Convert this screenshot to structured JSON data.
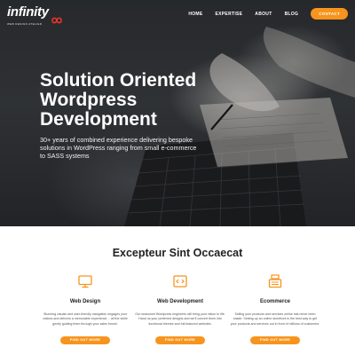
{
  "nav": {
    "logo_word": "infinity",
    "logo_sub": "WEB DESIGN ATELIER",
    "links": [
      "HOME",
      "EXPERTISE",
      "ABOUT",
      "BLOG"
    ],
    "contact_label": "CONTACT"
  },
  "hero": {
    "title_lines": [
      "Solution Oriented",
      "Wordpress",
      "Development"
    ],
    "subtitle": "30+ years of combined experience delivering bespoke solutions in WordPress ranging from small e-commerce to SASS systems"
  },
  "services": {
    "heading": "Excepteur Sint Occaecat",
    "cards": [
      {
        "icon": "monitor-icon",
        "title": "Web Design",
        "description": "Stunning visuals and user-friendly navigation engages your visitors and delivers a memorable experience… all the while gently guiding them through your sales funnel.",
        "button": "FIND OUT MORE"
      },
      {
        "icon": "code-icon",
        "title": "Web Development",
        "description": "Our seasoned Wordpress engineers will bring your vision to life. Hand us your preferred designs and we'll convert them into functional themes and full-featured websites.",
        "button": "FIND OUT MORE"
      },
      {
        "icon": "cash-register-icon",
        "title": "Ecommerce",
        "description": "Selling your products and services online has never been easier. Setting up an online storefront is the best way to get your products and services out in front of millions of customers.",
        "button": "FIND OUT MORE"
      }
    ]
  },
  "colors": {
    "accent": "#f7941d",
    "logo_mark": "#e8362a",
    "heading": "#222222",
    "body_text": "#555555"
  }
}
